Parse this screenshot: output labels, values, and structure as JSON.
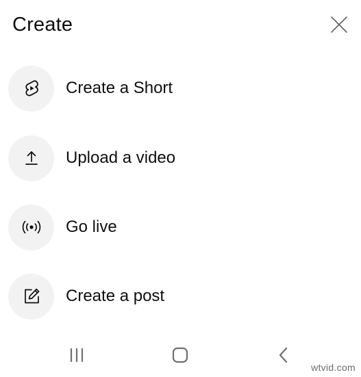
{
  "header": {
    "title": "Create"
  },
  "menu": {
    "items": [
      {
        "label": "Create a Short",
        "icon": "shorts-icon"
      },
      {
        "label": "Upload a video",
        "icon": "upload-icon"
      },
      {
        "label": "Go live",
        "icon": "live-broadcast-icon"
      },
      {
        "label": "Create a post",
        "icon": "edit-post-icon"
      }
    ]
  },
  "navbar": {
    "items": [
      "recent-apps-icon",
      "home-icon",
      "back-icon"
    ]
  },
  "watermark": {
    "text": "wtvid.com"
  },
  "colors": {
    "text": "#0f0f0f",
    "icon_bg": "#f2f2f2",
    "nav_icon": "#6f6f6f",
    "background": "#ffffff"
  }
}
